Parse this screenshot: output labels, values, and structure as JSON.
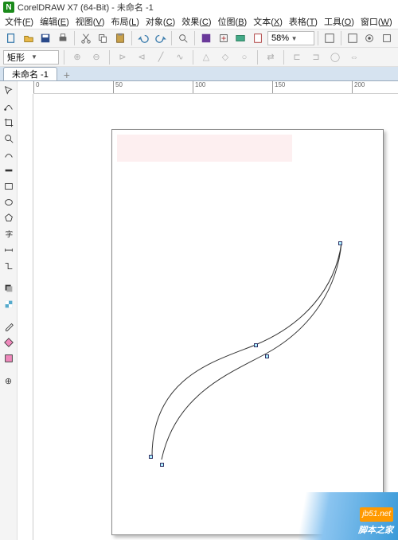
{
  "title": "CorelDRAW X7 (64-Bit) - 未命名 -1",
  "logo_letter": "N",
  "menu": [
    {
      "label": "文件",
      "key": "F"
    },
    {
      "label": "编辑",
      "key": "E"
    },
    {
      "label": "视图",
      "key": "V"
    },
    {
      "label": "布局",
      "key": "L"
    },
    {
      "label": "对象",
      "key": "C"
    },
    {
      "label": "效果",
      "key": "C"
    },
    {
      "label": "位图",
      "key": "B"
    },
    {
      "label": "文本",
      "key": "X"
    },
    {
      "label": "表格",
      "key": "T"
    },
    {
      "label": "工具",
      "key": "O"
    },
    {
      "label": "窗口",
      "key": "W"
    }
  ],
  "toolbar": {
    "zoom": "58%"
  },
  "propbar": {
    "shape": "矩形"
  },
  "tab": {
    "label": "未命名 -1"
  },
  "ruler_h": [
    "0",
    "50",
    "100",
    "150",
    "200"
  ],
  "watermark": {
    "site": "jb51.net",
    "text": "脚本之家"
  },
  "chart_data": null
}
